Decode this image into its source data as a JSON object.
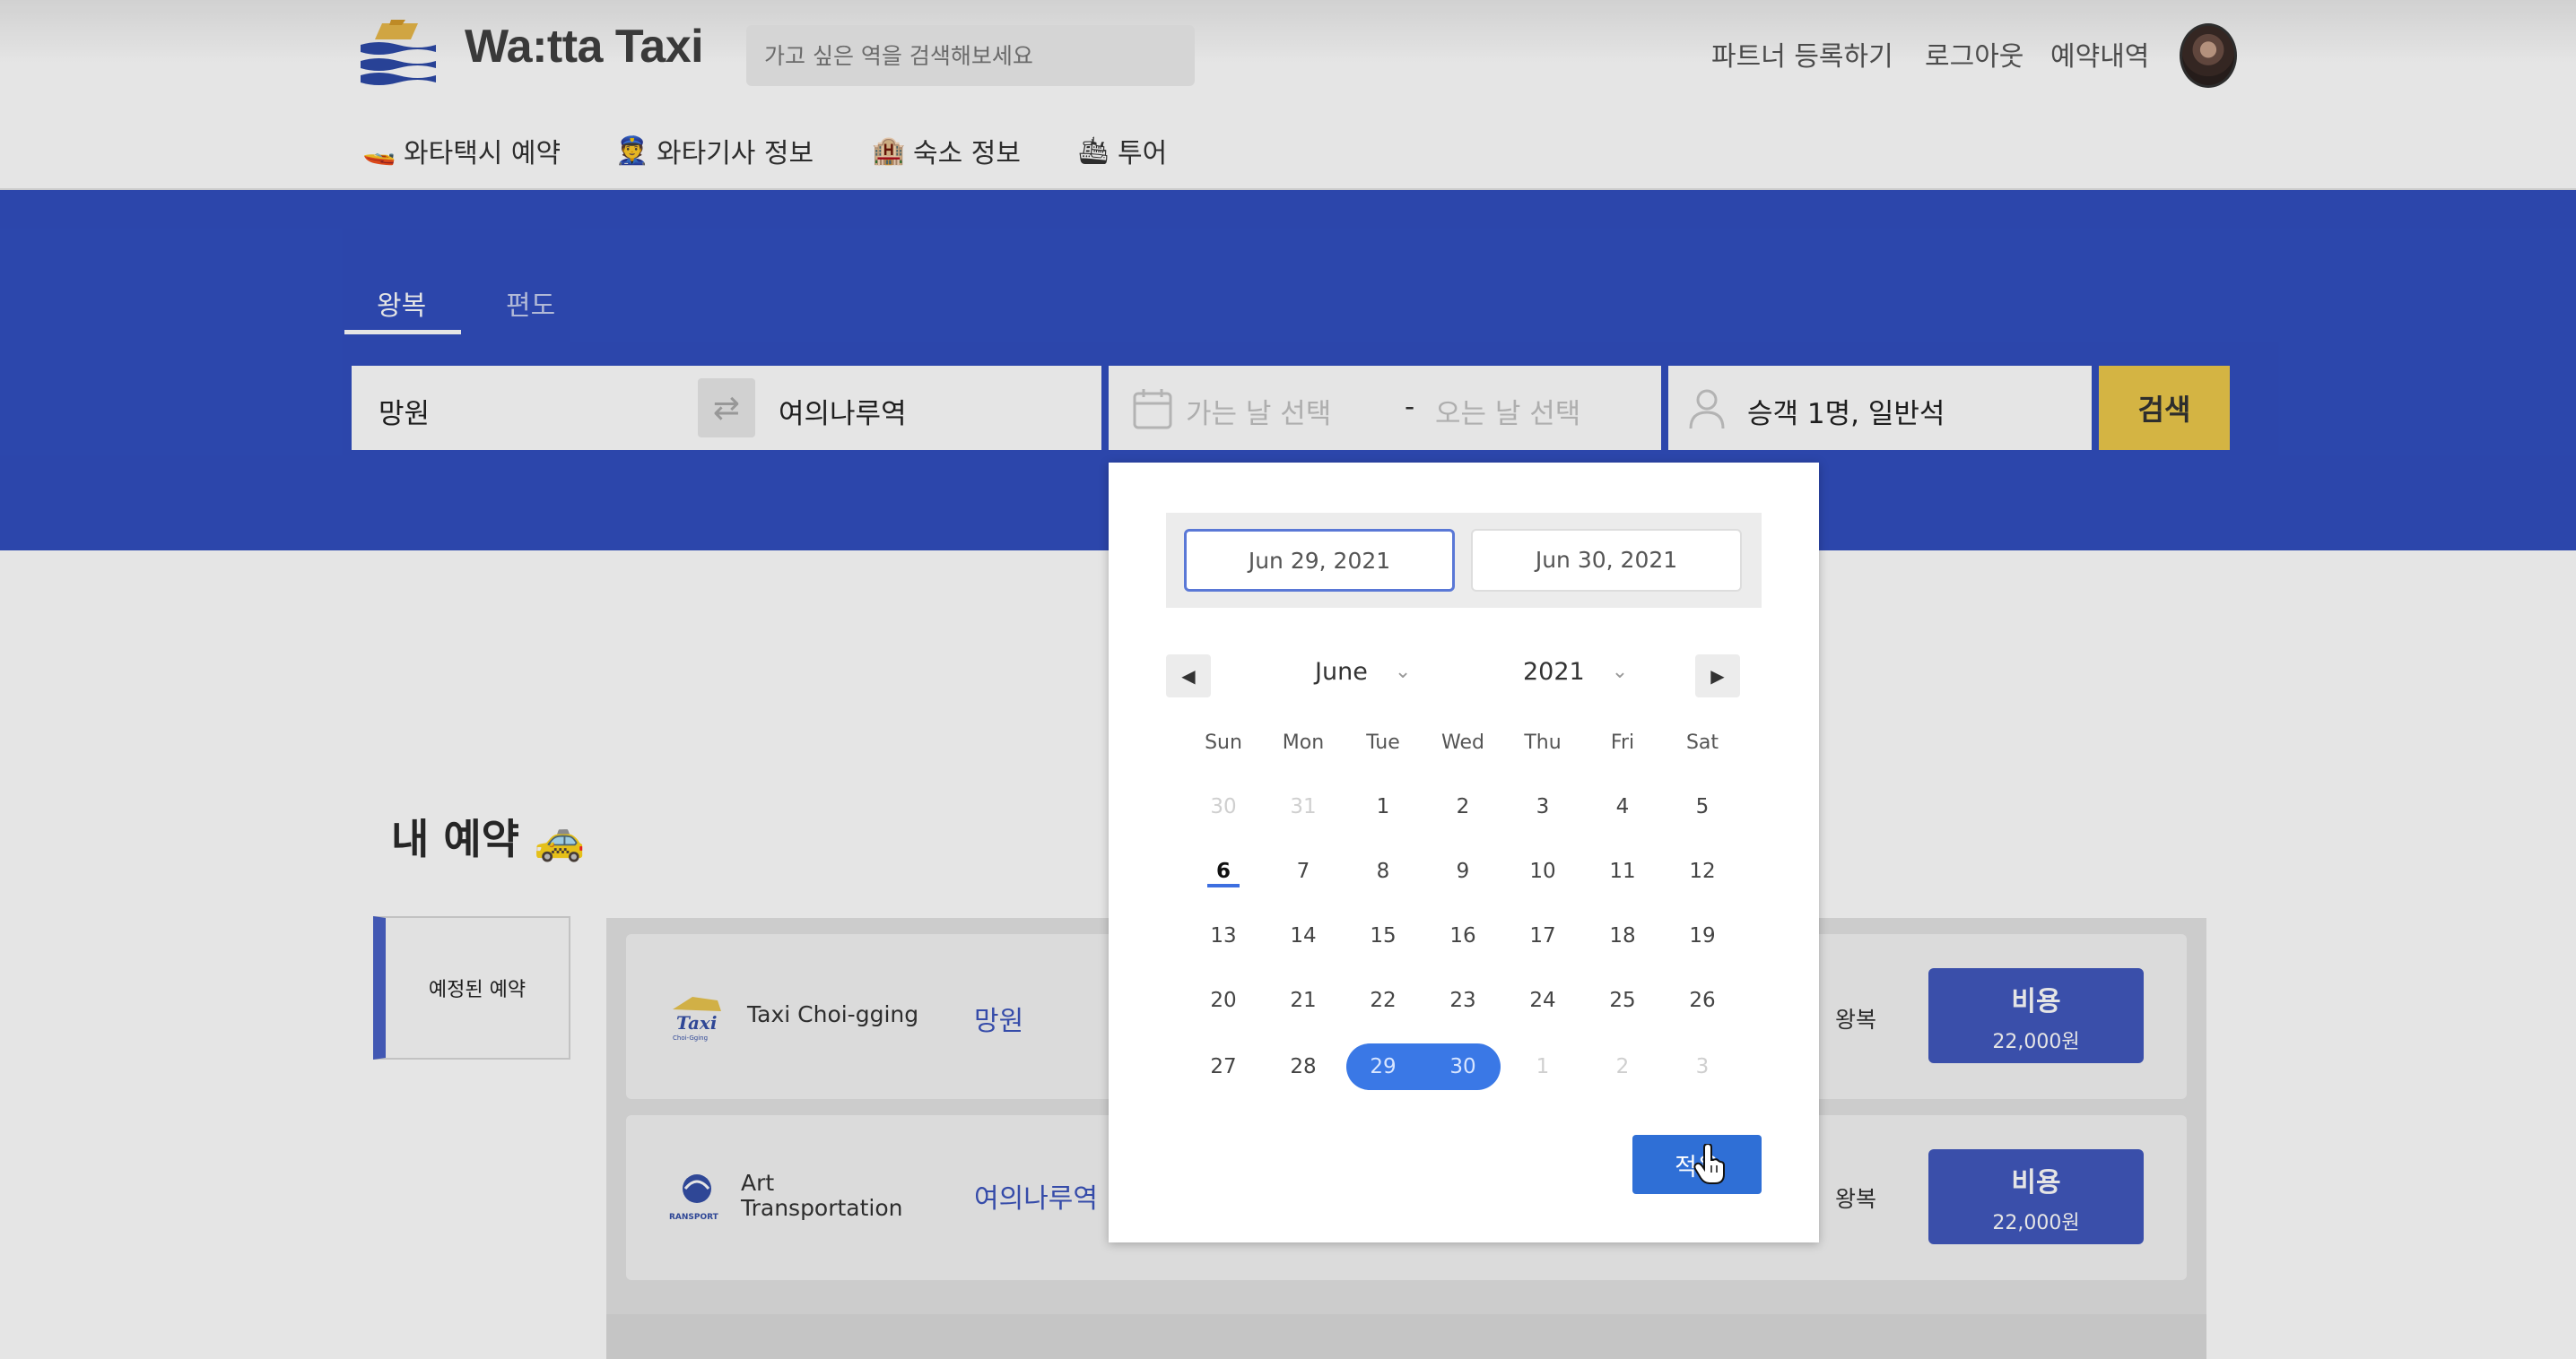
{
  "header": {
    "brand": "Wa:tta Taxi",
    "search_placeholder": "가고 싶은 역을 검색해보세요",
    "links": [
      "파트너 등록하기",
      "로그아웃",
      "예약내역"
    ]
  },
  "nav": [
    {
      "icon": "🚤",
      "label": "와타택시 예약"
    },
    {
      "icon": "👮",
      "label": "와타기사 정보"
    },
    {
      "icon": "🏨",
      "label": "숙소 정보"
    },
    {
      "icon": "🛳",
      "label": "투어"
    }
  ],
  "booking": {
    "tabs": [
      "왕복",
      "편도"
    ],
    "active_tab": "왕복",
    "from": "망원",
    "to": "여의나루역",
    "depart_placeholder": "가는 날 선택",
    "date_separator": "-",
    "return_placeholder": "오는 날 선택",
    "passengers": "승객 1명, 일반석",
    "search_label": "검색"
  },
  "my_bookings": {
    "title": "내 예약 🚕",
    "side_tab": "예정된 예약",
    "items": [
      {
        "company": "Taxi Choi-gging",
        "place": "망원",
        "trip": "왕복",
        "cost_label": "비용",
        "cost": "22,000원"
      },
      {
        "company": "Art\nTransportation",
        "place": "여의나루역",
        "trip": "왕복",
        "cost_label": "비용",
        "cost": "22,000원"
      }
    ]
  },
  "datepicker": {
    "start_date": "Jun 29, 2021",
    "end_date": "Jun 30, 2021",
    "month": "June",
    "year": "2021",
    "weekdays": [
      "Sun",
      "Mon",
      "Tue",
      "Wed",
      "Thu",
      "Fri",
      "Sat"
    ],
    "weeks": [
      [
        "30",
        "31",
        "1",
        "2",
        "3",
        "4",
        "5"
      ],
      [
        "6",
        "7",
        "8",
        "9",
        "10",
        "11",
        "12"
      ],
      [
        "13",
        "14",
        "15",
        "16",
        "17",
        "18",
        "19"
      ],
      [
        "20",
        "21",
        "22",
        "23",
        "24",
        "25",
        "26"
      ],
      [
        "27",
        "28",
        "29",
        "30",
        "1",
        "2",
        "3"
      ]
    ],
    "today": "6",
    "selected_range": [
      "29",
      "30"
    ],
    "apply_label": "적용"
  },
  "colors": {
    "hero_blue": "#314fbf",
    "search_yellow": "#ecc94b",
    "range_blue": "#3a78e6",
    "apply_blue": "#2f6fd6"
  }
}
